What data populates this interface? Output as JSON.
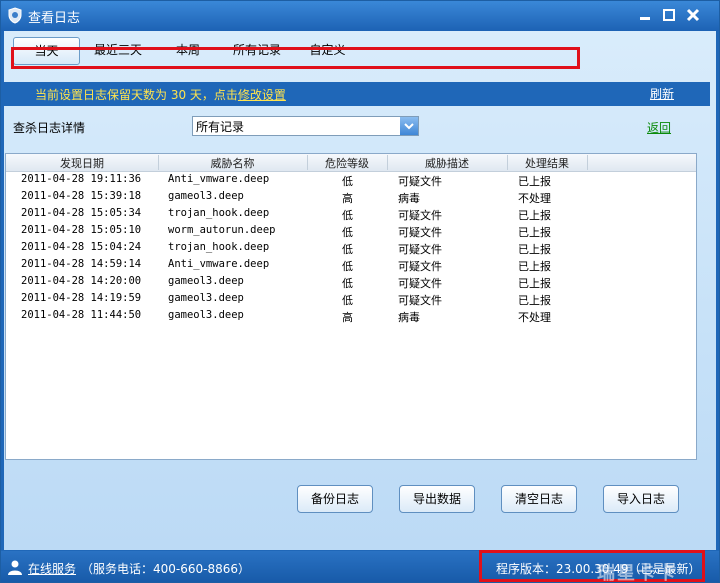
{
  "window": {
    "title": "查看日志"
  },
  "tabs": [
    "当天",
    "最近三天",
    "本周",
    "所有记录",
    "自定义"
  ],
  "notice": {
    "text": "当前设置日志保留天数为 30 天，点击",
    "link": "修改设置"
  },
  "refresh_label": "刷新",
  "filter": {
    "label": "查杀日志详情",
    "selected": "所有记录"
  },
  "back_label": "返回",
  "table": {
    "columns": [
      "发现日期",
      "威胁名称",
      "危险等级",
      "威胁描述",
      "处理结果"
    ],
    "rows": [
      [
        "2011-04-28 19:11:36",
        "Anti_vmware.deep",
        "低",
        "可疑文件",
        "已上报"
      ],
      [
        "2011-04-28 15:39:18",
        "gameol3.deep",
        "高",
        "病毒",
        "不处理"
      ],
      [
        "2011-04-28 15:05:34",
        "trojan_hook.deep",
        "低",
        "可疑文件",
        "已上报"
      ],
      [
        "2011-04-28 15:05:10",
        "worm_autorun.deep",
        "低",
        "可疑文件",
        "已上报"
      ],
      [
        "2011-04-28 15:04:24",
        "trojan_hook.deep",
        "低",
        "可疑文件",
        "已上报"
      ],
      [
        "2011-04-28 14:59:14",
        "Anti_vmware.deep",
        "低",
        "可疑文件",
        "已上报"
      ],
      [
        "2011-04-28 14:20:00",
        "gameol3.deep",
        "低",
        "可疑文件",
        "已上报"
      ],
      [
        "2011-04-28 14:19:59",
        "gameol3.deep",
        "低",
        "可疑文件",
        "已上报"
      ],
      [
        "2011-04-28 11:44:50",
        "gameol3.deep",
        "高",
        "病毒",
        "不处理"
      ]
    ]
  },
  "buttons": [
    "备份日志",
    "导出数据",
    "清空日志",
    "导入日志"
  ],
  "status": {
    "service_link": "在线服务",
    "phone": "（服务电话：400-660-8866）",
    "version": "程序版本：23.00.30.49（已是最新）"
  },
  "watermark": "瑞星卡卡",
  "colors": {
    "title_bar": "#1f67b8",
    "notice_text": "#ffe34d",
    "highlight_box": "#e0101a",
    "back_link": "#0a8a0a"
  },
  "icons": [
    "shield-icon",
    "minimize-icon",
    "maximize-icon",
    "close-icon",
    "dropdown-arrow-icon",
    "person-icon"
  ]
}
